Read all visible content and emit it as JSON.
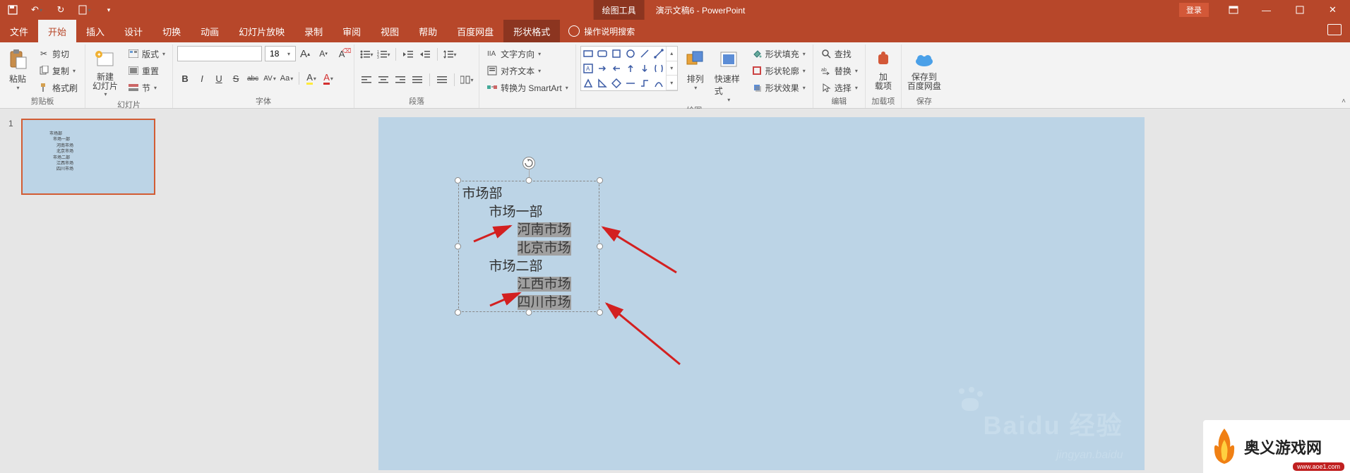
{
  "title_bar": {
    "context_tab": "绘图工具",
    "document_title": "演示文稿6 - PowerPoint",
    "login": "登录"
  },
  "tabs": {
    "file": "文件",
    "home": "开始",
    "insert": "插入",
    "design": "设计",
    "transitions": "切换",
    "animations": "动画",
    "slideshow": "幻灯片放映",
    "recording": "录制",
    "review": "审阅",
    "view": "视图",
    "help": "帮助",
    "baidu": "百度网盘",
    "shape_format": "形状格式",
    "tell_me": "操作说明搜索"
  },
  "ribbon": {
    "clipboard": {
      "label": "剪贴板",
      "paste": "粘贴",
      "cut": "剪切",
      "copy": "复制",
      "format_painter": "格式刷"
    },
    "slides": {
      "label": "幻灯片",
      "new_slide": "新建\n幻灯片",
      "layout": "版式",
      "reset": "重置",
      "section": "节"
    },
    "font": {
      "label": "字体",
      "size": "18",
      "bold": "B",
      "italic": "I",
      "underline": "U",
      "strike": "S",
      "shadow": "abc",
      "spacing": "AV",
      "case": "Aa",
      "grow": "A",
      "shrink": "A",
      "clear": "A",
      "color": "A"
    },
    "paragraph": {
      "label": "段落"
    },
    "pext": {
      "text_direction": "文字方向",
      "align_text": "对齐文本",
      "smartart": "转换为 SmartArt"
    },
    "drawing": {
      "label": "绘图",
      "arrange": "排列",
      "quick_styles": "快速样式",
      "shape_fill": "形状填充",
      "shape_outline": "形状轮廓",
      "shape_effects": "形状效果"
    },
    "editing": {
      "label": "编辑",
      "find": "查找",
      "replace": "替换",
      "select": "选择"
    },
    "addins": {
      "label": "加载项",
      "btn": "加\n载项"
    },
    "save": {
      "label": "保存",
      "btn": "保存到\n百度网盘"
    }
  },
  "thumb": {
    "number": "1"
  },
  "textbox": {
    "l1": "市场部",
    "l2a": "市场一部",
    "l3a": "河南市场",
    "l3b": "北京市场",
    "l2b": "市场二部",
    "l3c": "江西市场",
    "l3d": "四川市场"
  },
  "watermark": {
    "main": "Baidu 经验",
    "sub": "jingyan.baidu"
  },
  "brand": {
    "name": "奥义游戏网",
    "url": "www.aoe1.com"
  }
}
